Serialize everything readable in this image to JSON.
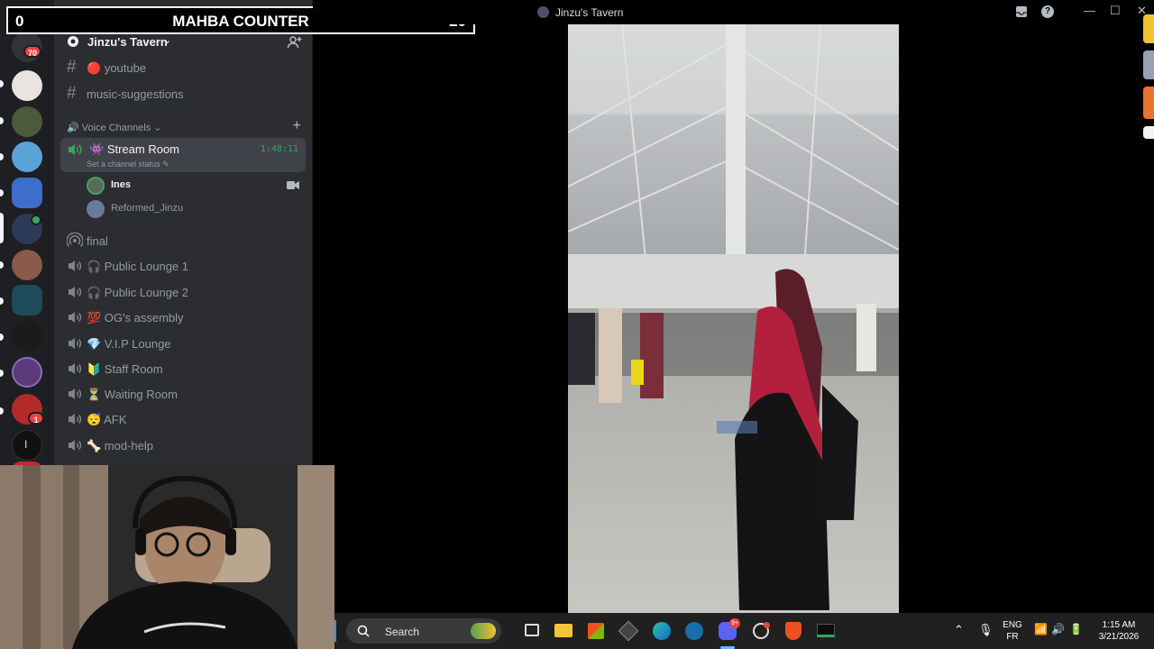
{
  "counter": {
    "left": "0",
    "title": "MAHBA COUNTER",
    "right": "20"
  },
  "rail": {
    "mail_badge": "70",
    "dm_badge": "1"
  },
  "guild": {
    "name": "Jinzu's Tavern",
    "chevron": "⌄"
  },
  "text_channels": [
    {
      "emoji": "🔴",
      "name": "youtube"
    },
    {
      "name": "music-suggestions"
    }
  ],
  "voice_category": {
    "label": "Voice Channels",
    "chevron": "⌄",
    "plus": "+"
  },
  "stream_room": {
    "emoji": "👾",
    "name": "Stream Room",
    "time": "1:48:11",
    "status": "Set a channel status"
  },
  "voice_users": [
    {
      "name": "Ines",
      "color": "#f2f3f5"
    },
    {
      "name": "Reformed_Jinzu",
      "color": "#949ba4"
    }
  ],
  "voice_channels": [
    {
      "name": "final"
    },
    {
      "name": "🎧 Public Lounge 1"
    },
    {
      "name": "🎧 Public Lounge 2"
    },
    {
      "name": "💯 OG's assembly"
    },
    {
      "name": "💎 V.I.P Lounge"
    },
    {
      "name": "🔰 Staff Room"
    },
    {
      "name": "⏳ Waiting Room"
    },
    {
      "name": "😴 AFK"
    },
    {
      "name": "🦴 mod-help"
    }
  ],
  "window": {
    "title": "Jinzu's Tavern"
  },
  "taskbar": {
    "search_label": "Search",
    "lang_top": "ENG",
    "lang_bottom": "FR",
    "time": "1:15 AM",
    "date": "3/21/2026",
    "discord_badge": "9+"
  },
  "colors": {
    "accent": "#5865f2",
    "online": "#3ba55d",
    "danger": "#f23f43"
  }
}
